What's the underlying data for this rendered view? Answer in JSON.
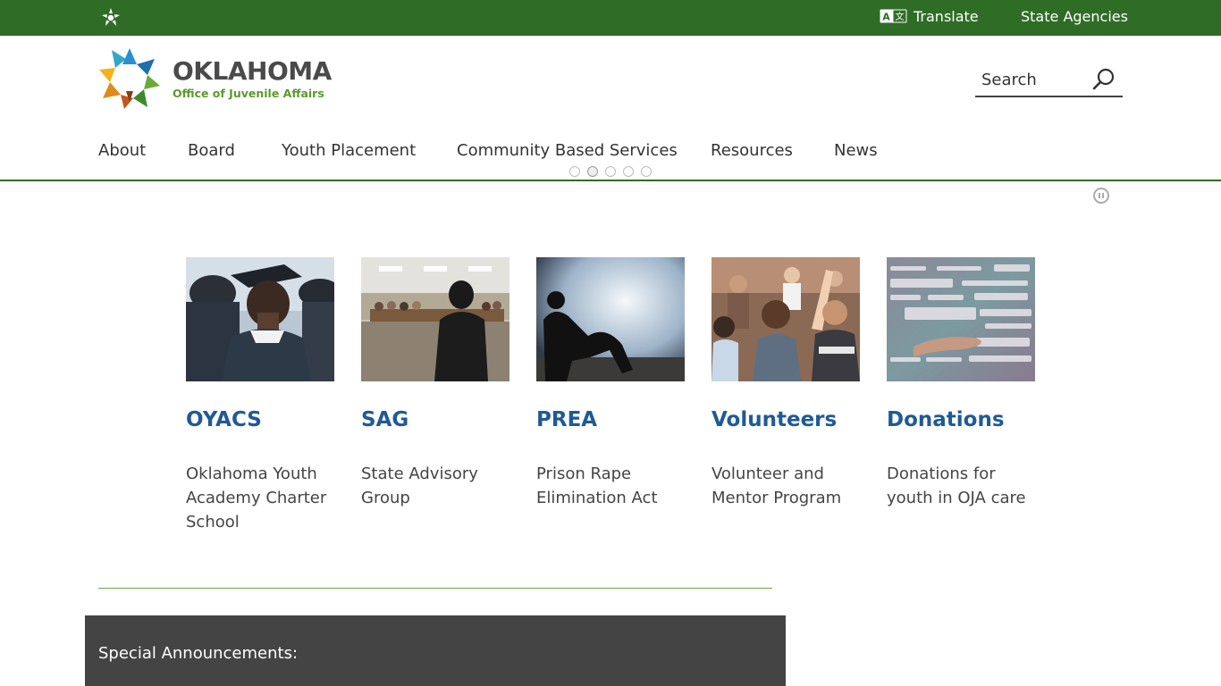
{
  "topbar": {
    "translate_label": "Translate",
    "agencies_label": "State Agencies",
    "bg_color": "#2f6d26"
  },
  "logo": {
    "wordmark": "OKLAHOMA",
    "subtitle": "Office of Juvenile Affairs"
  },
  "search": {
    "placeholder": "Search"
  },
  "nav": {
    "items": [
      {
        "label": "About"
      },
      {
        "label": "Board"
      },
      {
        "label": "Youth Placement"
      },
      {
        "label": "Community Based Services"
      },
      {
        "label": "Resources"
      },
      {
        "label": "News"
      }
    ]
  },
  "carousel": {
    "slide_count": 5,
    "active_index": 1
  },
  "cards": [
    {
      "title": "OYACS",
      "description": "Oklahoma Youth Academy Charter School",
      "image": "graduates-photo"
    },
    {
      "title": "SAG",
      "description": "State Advisory Group",
      "image": "meeting-photo"
    },
    {
      "title": "PREA",
      "description": "Prison Rape Elimination Act",
      "image": "silhouette-photo"
    },
    {
      "title": "Volunteers",
      "description": "Volunteer and Mentor Program",
      "image": "audience-photo"
    },
    {
      "title": "Donations",
      "description": "Donations for youth in OJA care",
      "image": "charity-word-cloud-photo"
    }
  ],
  "announcements": {
    "heading": "Special Announcements:"
  },
  "colors": {
    "link": "#1f5a96",
    "accent": "#2f6d26",
    "divider": "#6ea548",
    "announce_bg": "#444444"
  }
}
